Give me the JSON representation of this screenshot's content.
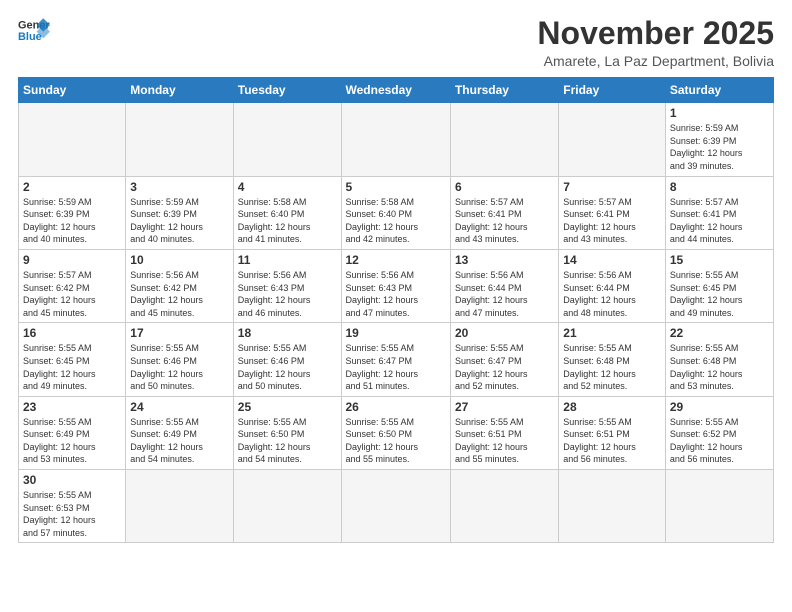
{
  "logo": {
    "general": "General",
    "blue": "Blue"
  },
  "title": "November 2025",
  "subtitle": "Amarete, La Paz Department, Bolivia",
  "days_header": [
    "Sunday",
    "Monday",
    "Tuesday",
    "Wednesday",
    "Thursday",
    "Friday",
    "Saturday"
  ],
  "weeks": [
    [
      {
        "day": "",
        "info": ""
      },
      {
        "day": "",
        "info": ""
      },
      {
        "day": "",
        "info": ""
      },
      {
        "day": "",
        "info": ""
      },
      {
        "day": "",
        "info": ""
      },
      {
        "day": "",
        "info": ""
      },
      {
        "day": "1",
        "info": "Sunrise: 5:59 AM\nSunset: 6:39 PM\nDaylight: 12 hours\nand 39 minutes."
      }
    ],
    [
      {
        "day": "2",
        "info": "Sunrise: 5:59 AM\nSunset: 6:39 PM\nDaylight: 12 hours\nand 40 minutes."
      },
      {
        "day": "3",
        "info": "Sunrise: 5:59 AM\nSunset: 6:39 PM\nDaylight: 12 hours\nand 40 minutes."
      },
      {
        "day": "4",
        "info": "Sunrise: 5:58 AM\nSunset: 6:40 PM\nDaylight: 12 hours\nand 41 minutes."
      },
      {
        "day": "5",
        "info": "Sunrise: 5:58 AM\nSunset: 6:40 PM\nDaylight: 12 hours\nand 42 minutes."
      },
      {
        "day": "6",
        "info": "Sunrise: 5:57 AM\nSunset: 6:41 PM\nDaylight: 12 hours\nand 43 minutes."
      },
      {
        "day": "7",
        "info": "Sunrise: 5:57 AM\nSunset: 6:41 PM\nDaylight: 12 hours\nand 43 minutes."
      },
      {
        "day": "8",
        "info": "Sunrise: 5:57 AM\nSunset: 6:41 PM\nDaylight: 12 hours\nand 44 minutes."
      }
    ],
    [
      {
        "day": "9",
        "info": "Sunrise: 5:57 AM\nSunset: 6:42 PM\nDaylight: 12 hours\nand 45 minutes."
      },
      {
        "day": "10",
        "info": "Sunrise: 5:56 AM\nSunset: 6:42 PM\nDaylight: 12 hours\nand 45 minutes."
      },
      {
        "day": "11",
        "info": "Sunrise: 5:56 AM\nSunset: 6:43 PM\nDaylight: 12 hours\nand 46 minutes."
      },
      {
        "day": "12",
        "info": "Sunrise: 5:56 AM\nSunset: 6:43 PM\nDaylight: 12 hours\nand 47 minutes."
      },
      {
        "day": "13",
        "info": "Sunrise: 5:56 AM\nSunset: 6:44 PM\nDaylight: 12 hours\nand 47 minutes."
      },
      {
        "day": "14",
        "info": "Sunrise: 5:56 AM\nSunset: 6:44 PM\nDaylight: 12 hours\nand 48 minutes."
      },
      {
        "day": "15",
        "info": "Sunrise: 5:55 AM\nSunset: 6:45 PM\nDaylight: 12 hours\nand 49 minutes."
      }
    ],
    [
      {
        "day": "16",
        "info": "Sunrise: 5:55 AM\nSunset: 6:45 PM\nDaylight: 12 hours\nand 49 minutes."
      },
      {
        "day": "17",
        "info": "Sunrise: 5:55 AM\nSunset: 6:46 PM\nDaylight: 12 hours\nand 50 minutes."
      },
      {
        "day": "18",
        "info": "Sunrise: 5:55 AM\nSunset: 6:46 PM\nDaylight: 12 hours\nand 50 minutes."
      },
      {
        "day": "19",
        "info": "Sunrise: 5:55 AM\nSunset: 6:47 PM\nDaylight: 12 hours\nand 51 minutes."
      },
      {
        "day": "20",
        "info": "Sunrise: 5:55 AM\nSunset: 6:47 PM\nDaylight: 12 hours\nand 52 minutes."
      },
      {
        "day": "21",
        "info": "Sunrise: 5:55 AM\nSunset: 6:48 PM\nDaylight: 12 hours\nand 52 minutes."
      },
      {
        "day": "22",
        "info": "Sunrise: 5:55 AM\nSunset: 6:48 PM\nDaylight: 12 hours\nand 53 minutes."
      }
    ],
    [
      {
        "day": "23",
        "info": "Sunrise: 5:55 AM\nSunset: 6:49 PM\nDaylight: 12 hours\nand 53 minutes."
      },
      {
        "day": "24",
        "info": "Sunrise: 5:55 AM\nSunset: 6:49 PM\nDaylight: 12 hours\nand 54 minutes."
      },
      {
        "day": "25",
        "info": "Sunrise: 5:55 AM\nSunset: 6:50 PM\nDaylight: 12 hours\nand 54 minutes."
      },
      {
        "day": "26",
        "info": "Sunrise: 5:55 AM\nSunset: 6:50 PM\nDaylight: 12 hours\nand 55 minutes."
      },
      {
        "day": "27",
        "info": "Sunrise: 5:55 AM\nSunset: 6:51 PM\nDaylight: 12 hours\nand 55 minutes."
      },
      {
        "day": "28",
        "info": "Sunrise: 5:55 AM\nSunset: 6:51 PM\nDaylight: 12 hours\nand 56 minutes."
      },
      {
        "day": "29",
        "info": "Sunrise: 5:55 AM\nSunset: 6:52 PM\nDaylight: 12 hours\nand 56 minutes."
      }
    ],
    [
      {
        "day": "30",
        "info": "Sunrise: 5:55 AM\nSunset: 6:53 PM\nDaylight: 12 hours\nand 57 minutes."
      },
      {
        "day": "",
        "info": ""
      },
      {
        "day": "",
        "info": ""
      },
      {
        "day": "",
        "info": ""
      },
      {
        "day": "",
        "info": ""
      },
      {
        "day": "",
        "info": ""
      },
      {
        "day": "",
        "info": ""
      }
    ]
  ]
}
